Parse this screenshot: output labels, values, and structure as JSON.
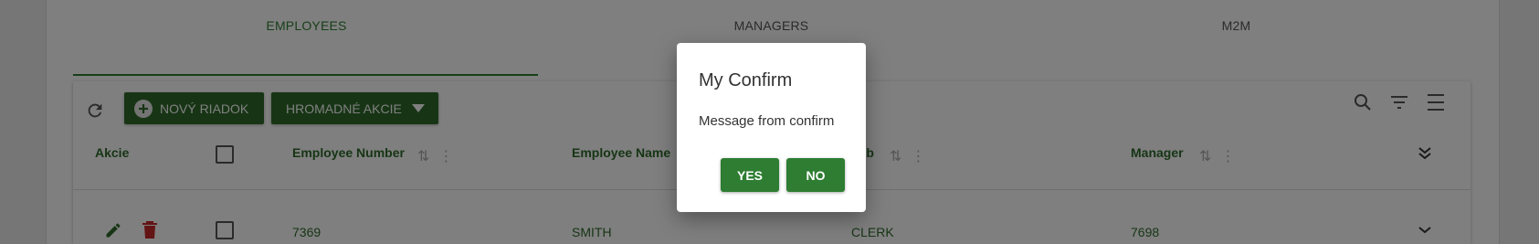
{
  "tabs": [
    {
      "label": "EMPLOYEES",
      "active": true
    },
    {
      "label": "MANAGERS",
      "active": false
    },
    {
      "label": "M2M",
      "active": false
    }
  ],
  "toolbar": {
    "new_row_label": "NOVÝ RIADOK",
    "bulk_actions_label": "HROMADNÉ AKCIE"
  },
  "columns": {
    "actions": "Akcie",
    "employee_number": "Employee Number",
    "employee_name": "Employee Name",
    "job": "Job",
    "manager": "Manager"
  },
  "rows": [
    {
      "employee_number": "7369",
      "employee_name": "SMITH",
      "job": "CLERK",
      "manager": "7698"
    }
  ],
  "dialog": {
    "title": "My Confirm",
    "message": "Message from confirm",
    "yes_label": "YES",
    "no_label": "NO"
  },
  "colors": {
    "accent": "#2e7d32",
    "button": "#2e6b2a",
    "delete": "#c62828",
    "overlay": "rgba(0,0,0,0.5)"
  }
}
